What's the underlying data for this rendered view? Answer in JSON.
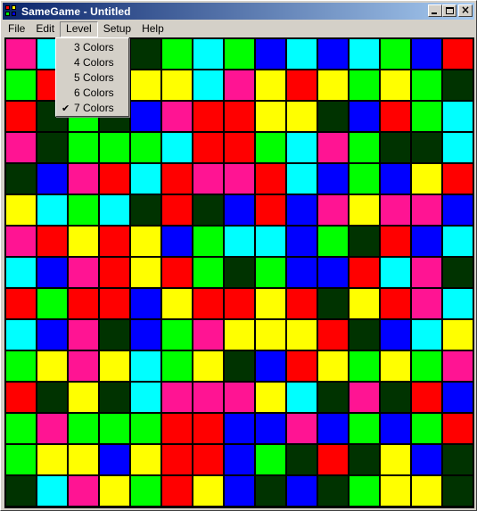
{
  "window": {
    "title": "SameGame - Untitled"
  },
  "title_buttons": [
    "minimize",
    "maximize",
    "close"
  ],
  "menu": {
    "items": [
      {
        "label": "File"
      },
      {
        "label": "Edit"
      },
      {
        "label": "Level"
      },
      {
        "label": "Setup"
      },
      {
        "label": "Help"
      }
    ],
    "open": "Level"
  },
  "level_menu": {
    "items": [
      {
        "label": "3 Colors",
        "checked": false
      },
      {
        "label": "4 Colors",
        "checked": false
      },
      {
        "label": "5 Colors",
        "checked": false
      },
      {
        "label": "6 Colors",
        "checked": false
      },
      {
        "label": "7 Colors",
        "checked": true
      }
    ],
    "check_glyph": "✔"
  },
  "palette": {
    "P": "#ff1493",
    "C": "#00ffff",
    "D": "#003300",
    "G": "#00ff00",
    "B": "#0000ff",
    "R": "#ff0000",
    "Y": "#ffff00"
  },
  "board": {
    "columns": 15,
    "rows": [
      "PCDDDGCGBCBCGBR",
      "GRGGYYCPYRYGYGD",
      "RDGDBPRRYYDBRGC",
      "PDGGGCRRGCPGDDC",
      "DBPRCRPPRCBGBYR",
      "YCGCDRDBRBPYPPB",
      "PRYRYBGCCBGDRBC",
      "CBPRYRGDGBBRCPD",
      "RGRRBYRRYRDYRPC",
      "CBPDBGPYYYRDBCY",
      "GYPYCGYDBRYGYGP",
      "RDYDCPPPYCDPDRB",
      "GPGGGRRBBPBGBGR",
      "GYYBYRRBGDRDYBD",
      "DCPYGRYBDBDGYYD"
    ]
  }
}
